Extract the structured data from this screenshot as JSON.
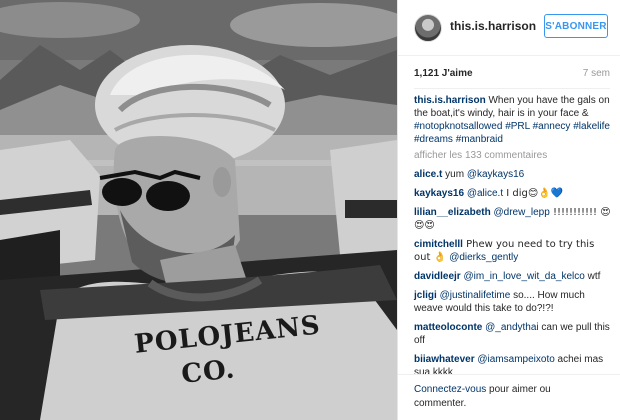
{
  "header": {
    "username": "this.is.harrison",
    "follow_label": "S'ABONNER"
  },
  "post": {
    "likes": "1,121 J'aime",
    "time": "7 sem",
    "caption": {
      "author": "this.is.harrison",
      "text": " When you have the gals on the boat,it's windy, hair is in your face & ",
      "tags": [
        "#notopknotsallowed",
        "#PRL",
        "#annecy",
        "#lakelife",
        "#dreams",
        "#manbraid"
      ]
    },
    "more_comments": "afficher les 133 commentaires",
    "comments": [
      {
        "user": "alice.t",
        "mention": "@kaykays16",
        "text": " yum",
        "after": ""
      },
      {
        "user": "kaykays16",
        "mention": "@alice.t",
        "text": "",
        "after": " I dig😊👌💙"
      },
      {
        "user": "lilian__elizabeth",
        "mention": "@drew_lepp",
        "text": "",
        "after": " !!!!!!!!!!! 😍😍😍"
      },
      {
        "user": "cimitchelll",
        "mention": "@dierks_gently",
        "text": " Phew you need to try this out 👌 ",
        "after": ""
      },
      {
        "user": "davidleejr",
        "mention": "@im_in_love_wit_da_kelco",
        "text": "",
        "after": " wtf"
      },
      {
        "user": "jcligi",
        "mention": "@justinalifetime",
        "text": "",
        "after": " so.... How much weave would this take to do?!?!"
      },
      {
        "user": "matteoloconte",
        "mention": "@_andythai",
        "text": "",
        "after": " can we pull this off"
      },
      {
        "user": "biiawhatever",
        "mention": "@iamsampeixoto",
        "text": "",
        "after": " achei mas sua kkkk"
      }
    ]
  },
  "footer": {
    "login_link": "Connectez-vous",
    "login_text": " pour aimer ou commenter."
  },
  "photo": {
    "shirt_line1": "POLOJEANS",
    "shirt_line2": "CO."
  },
  "colors": {
    "accent": "#3897f0",
    "link": "#003569",
    "muted": "#999999"
  }
}
